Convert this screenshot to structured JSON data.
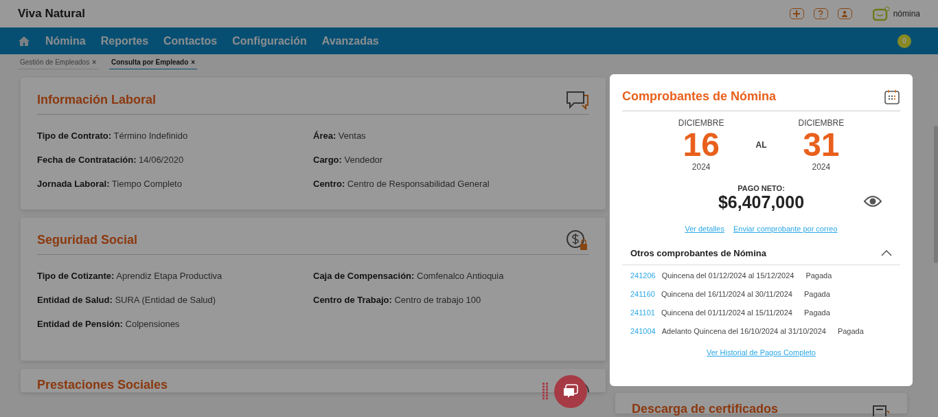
{
  "app": {
    "title": "Viva Natural",
    "brand_label": "nómina",
    "notification_count": "0"
  },
  "nav": {
    "items": [
      {
        "label": "Nómina"
      },
      {
        "label": "Reportes"
      },
      {
        "label": "Contactos"
      },
      {
        "label": "Configuración"
      },
      {
        "label": "Avanzadas"
      }
    ]
  },
  "tabs": [
    {
      "label": "Gestión de Empleados",
      "close": "×",
      "selected": false
    },
    {
      "label": "Consulta por Empleado",
      "close": "×",
      "selected": true
    }
  ],
  "cards": [
    {
      "title": "Información Laboral",
      "columns": [
        [
          {
            "label": "Tipo de Contrato:",
            "value": "Término Indefinido"
          },
          {
            "label": "Fecha de Contratación:",
            "value": "14/06/2020"
          },
          {
            "label": "Jornada Laboral:",
            "value": "Tiempo Completo"
          }
        ],
        [
          {
            "label": "Área:",
            "value": "Ventas"
          },
          {
            "label": "Cargo:",
            "value": "Vendedor"
          },
          {
            "label": "Centro:",
            "value": "Centro de Responsabilidad General"
          }
        ]
      ]
    },
    {
      "title": "Seguridad Social",
      "columns": [
        [
          {
            "label": "Tipo de Cotizante:",
            "value": "Aprendiz Etapa Productiva"
          },
          {
            "label": "Entidad de Salud:",
            "value": "SURA (Entidad de Salud)"
          },
          {
            "label": "Entidad de Pensión:",
            "value": "Colpensiones"
          }
        ],
        [
          {
            "label": "Caja de Compensación:",
            "value": "Comfenalco Antioquia"
          },
          {
            "label": "Centro de Trabajo:",
            "value": "Centro de trabajo 100"
          }
        ]
      ]
    },
    {
      "title": "Prestaciones Sociales"
    }
  ],
  "payslip": {
    "title": "Comprobantes de Nómina",
    "from": {
      "month": "DICIEMBRE",
      "day": "16",
      "year": "2024"
    },
    "separator": "AL",
    "to": {
      "month": "DICIEMBRE",
      "day": "31",
      "year": "2024"
    },
    "net_label": "PAGO NETO:",
    "net_amount": "$6,407,000",
    "links": [
      "Ver detalles",
      "Enviar comprobante por correo"
    ],
    "others_title": "Otros comprobantes de Nómina",
    "others_expanded": true,
    "others": [
      {
        "id": "241206",
        "description": "Quincena del 01/12/2024 al 15/12/2024",
        "status": "Pagada"
      },
      {
        "id": "241160",
        "description": "Quincena del 16/11/2024 al 30/11/2024",
        "status": "Pagada"
      },
      {
        "id": "241101",
        "description": "Quincena del 01/11/2024 al 15/11/2024",
        "status": "Pagada"
      },
      {
        "id": "241004",
        "description": "Adelanto Quincena del 16/10/2024 al 31/10/2024",
        "status": "Pagada"
      }
    ],
    "history_link": "Ver Historial de Pagos Completo"
  },
  "certificates": {
    "title": "Descarga de certificados"
  }
}
